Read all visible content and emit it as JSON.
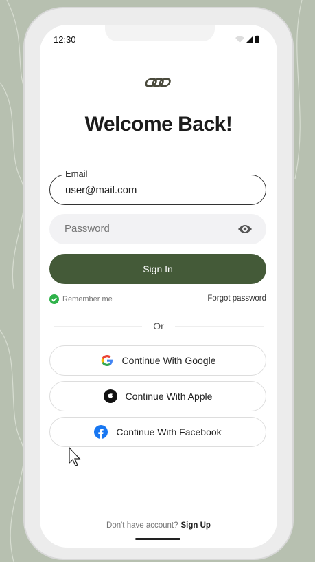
{
  "status": {
    "time": "12:30"
  },
  "title": "Welcome Back!",
  "email": {
    "label": "Email",
    "value": "user@mail.com"
  },
  "password": {
    "placeholder": "Password"
  },
  "sign_in": "Sign In",
  "remember": "Remember me",
  "forgot": "Forgot password",
  "divider": "Or",
  "social": [
    {
      "label": "Continue With Google",
      "icon": "google-icon"
    },
    {
      "label": "Continue With Apple",
      "icon": "apple-icon"
    },
    {
      "label": "Continue With Facebook",
      "icon": "facebook-icon"
    }
  ],
  "footer": {
    "prompt": "Don't have account?",
    "link": "Sign Up"
  },
  "colors": {
    "primary": "#445a38",
    "check": "#2fb24a",
    "background": "#b7c0b0"
  }
}
